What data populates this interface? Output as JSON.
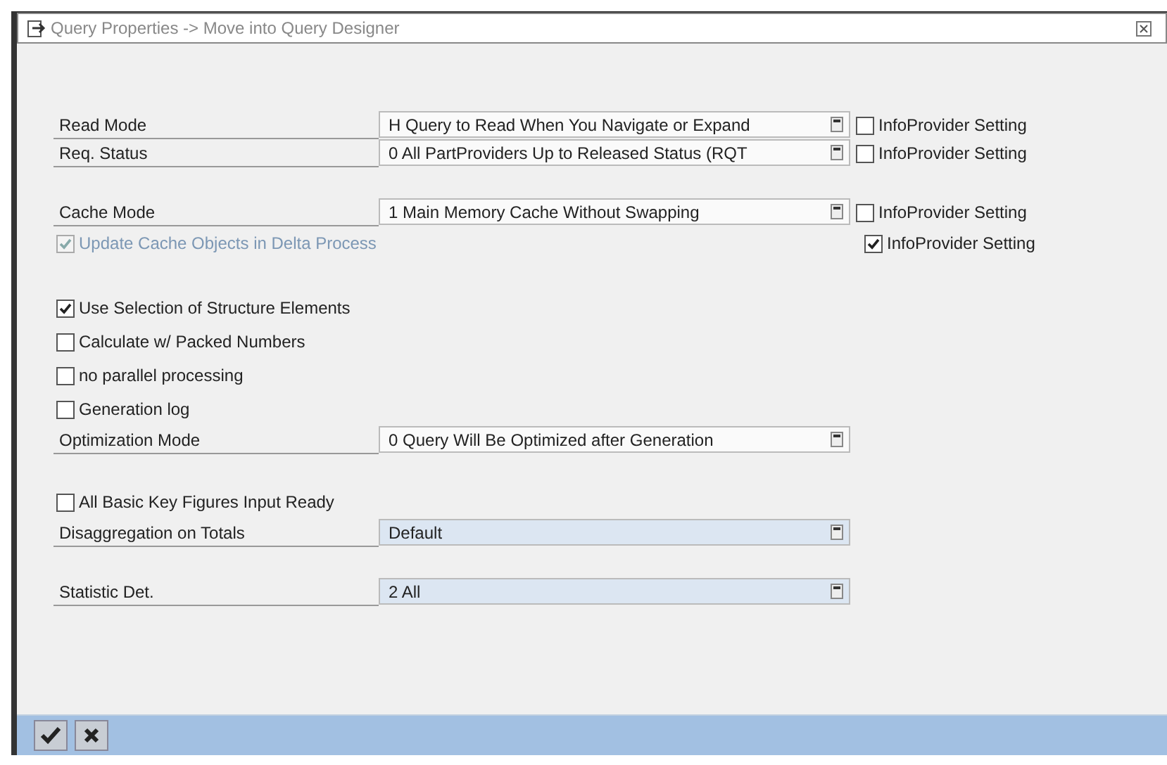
{
  "window": {
    "title": "Query Properties -> Move into Query Designer"
  },
  "groups": [
    [
      {
        "kind": "field",
        "label": "Read Mode",
        "value": "H Query to Read When You Navigate or Expand",
        "input_ready": true,
        "infoprovider": {
          "label": "InfoProvider Setting",
          "checked": false
        }
      },
      {
        "kind": "field",
        "label": "Req. Status",
        "value": "0 All PartProviders Up to Released Status (RQT",
        "input_ready": true,
        "infoprovider": {
          "label": "InfoProvider Setting",
          "checked": false
        }
      }
    ],
    [
      {
        "kind": "field",
        "label": "Cache Mode",
        "value": "1 Main Memory Cache Without Swapping",
        "input_ready": true,
        "infoprovider": {
          "label": "InfoProvider Setting",
          "checked": false
        }
      },
      {
        "kind": "check",
        "label": "Update Cache Objects in Delta Process",
        "checked": true,
        "disabled": true,
        "infoprovider": {
          "label": "InfoProvider Setting",
          "checked": true
        }
      }
    ],
    [
      {
        "kind": "check",
        "label": "Use Selection of Structure Elements",
        "checked": true,
        "disabled": false
      },
      {
        "kind": "check",
        "label": "Calculate w/ Packed Numbers",
        "checked": false,
        "disabled": false
      },
      {
        "kind": "check",
        "label": "no parallel processing",
        "checked": false,
        "disabled": false
      },
      {
        "kind": "check",
        "label": "Generation log",
        "checked": false,
        "disabled": false
      },
      {
        "kind": "field",
        "label": "Optimization Mode",
        "value": "0 Query Will Be Optimized after Generation",
        "input_ready": true
      }
    ],
    [
      {
        "kind": "check",
        "label": "All Basic Key Figures Input Ready",
        "checked": false,
        "disabled": false
      },
      {
        "kind": "field",
        "label": "Disaggregation on Totals",
        "value": "Default",
        "input_ready": false
      }
    ],
    [
      {
        "kind": "field",
        "label": "Statistic Det.",
        "value": "2 All",
        "input_ready": false
      }
    ]
  ],
  "footer": {
    "buttons": [
      {
        "kind": "confirm"
      },
      {
        "kind": "cancel"
      }
    ]
  }
}
